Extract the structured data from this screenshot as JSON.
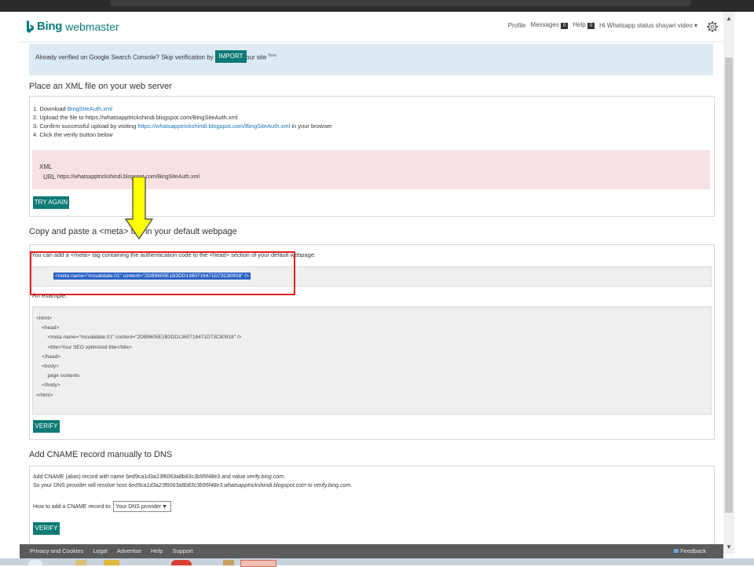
{
  "header": {
    "brand": "Bing",
    "product": "webmaster",
    "nav": {
      "profile": "Profile",
      "messages": "Messages",
      "messages_count": "0",
      "help": "Help",
      "help_count": "0",
      "user": "Hi Whatsapp status shayari video",
      "user_caret": "▾"
    }
  },
  "import_bar": {
    "text": "Already verified on Google Search Console? Skip verification by importing your site",
    "beta": "Beta",
    "button": "IMPORT"
  },
  "xml_section": {
    "title": "Place an XML file on your web server",
    "steps": [
      {
        "prefix": "1. Download ",
        "link": "BingSiteAuth.xml",
        "suffix": ""
      },
      {
        "prefix": "2. Upload the file to https://whatsapptrickshindi.blogspot.com/BingSiteAuth.xml",
        "link": "",
        "suffix": ""
      },
      {
        "prefix": "3. Confirm successful upload by visiting ",
        "link": "https://whatsapptrickshindi.blogspot.com/BingSiteAuth.xml",
        "suffix": " in your browser"
      },
      {
        "prefix": "4. Click the verify button below",
        "link": "",
        "suffix": ""
      }
    ],
    "error_label_xml": "XML",
    "error_label_url": "URL",
    "error_url": "https://whatsapptrickshindi.blogspot.com/BingSiteAuth.xml",
    "try_again": "TRY AGAIN"
  },
  "meta_section": {
    "title": "Copy and paste a <meta> tag in your default webpage",
    "description": "You can add a <meta> tag containing the authentication code to the <head> section of your default webpage.",
    "meta_tag": "<meta name=\"msvalidate.01\" content=\"2DB9605E1B3DD1360716471D73C80918\" />",
    "example_label": "An example:",
    "example_code": [
      "<html>",
      "    <head>",
      "        <meta name=\"msvalidate.01\" content=\"2DB9605E1B3DD1360716471D73C80918\" />",
      "        <title>Your SEO optimized title</title>",
      "    </head>",
      "    <body>",
      "        page contents",
      "    </body>",
      "</html>"
    ],
    "verify": "VERIFY"
  },
  "cname_section": {
    "title": "Add CNAME record manually to DNS",
    "line1_prefix": "Add CNAME (alias) record with name 6ed9ca1d3a23f6063a8b83c3b95f48e3 and value ",
    "line1_value": "verify.bing.com",
    "line1_suffix": ".",
    "line2_prefix": "So your DNS provider will resolve host ",
    "line2_host": "6ed9ca1d3a23f6063a8b83c3b95f48e3.whatsapptrickshindi.blogspot.com",
    "line2_mid": " to ",
    "line2_value": "verify.bing.com",
    "line2_suffix": ".",
    "howto_label": "How to add a CNAME record to:",
    "dns_selected": "Your DNS provider",
    "verify": "VERIFY"
  },
  "footer": {
    "links": [
      "Privacy and Cookies",
      "Legal",
      "Advertise",
      "Help",
      "Support"
    ],
    "feedback": "Feedback"
  },
  "scrollbar": {
    "up": "▲",
    "down": "▼"
  },
  "colors": {
    "accent": "#0d7a75",
    "import_bar_bg": "#dde9f3",
    "error_bg": "#f8e1e3",
    "annotation_rect": "#e02020",
    "annotation_arrow": "#ffff00"
  }
}
